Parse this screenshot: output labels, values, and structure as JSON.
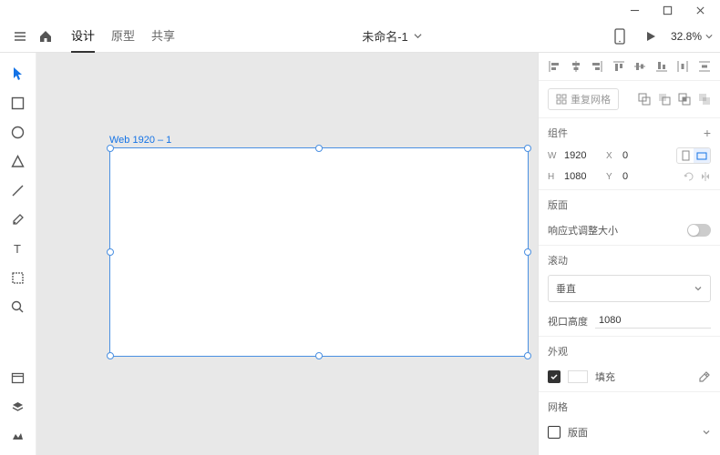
{
  "window": {
    "title": "未命名-1"
  },
  "topbar": {
    "tabs": {
      "design": "设计",
      "prototype": "原型",
      "share": "共享"
    },
    "zoom": "32.8%"
  },
  "canvas": {
    "artboard_label": "Web 1920 – 1"
  },
  "panel": {
    "repeat_grid": "重复网格",
    "components": "组件",
    "size": {
      "w_label": "W",
      "w": "1920",
      "h_label": "H",
      "h": "1080",
      "x_label": "X",
      "x": "0",
      "y_label": "Y",
      "y": "0"
    },
    "responsive_section": "版面",
    "responsive_label": "响应式调整大小",
    "scrolling_section": "滚动",
    "scrolling_value": "垂直",
    "viewport_label": "视口高度",
    "viewport_value": "1080",
    "appearance_section": "外观",
    "fill_label": "填充",
    "grid_section": "网格",
    "grid_value": "版面"
  }
}
